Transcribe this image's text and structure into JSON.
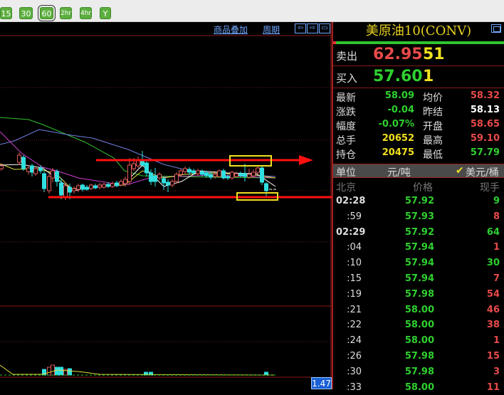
{
  "toolbar": {
    "periods": [
      "15",
      "30",
      "60",
      "2hr",
      "4hr",
      "Y"
    ],
    "selected": "60"
  },
  "chart": {
    "overlay_link": "商品叠加",
    "period_link": "周期",
    "icons": [
      "arrow-left-icon",
      "arrow-right-icon",
      "panel-toggle-icon"
    ],
    "volume_badge": "1.47"
  },
  "panel": {
    "title": "美原油10(CONV)",
    "sell": {
      "label": "卖出",
      "price": "62.95",
      "qty": "51"
    },
    "buy": {
      "label": "买入",
      "price": "57.60",
      "qty": "1"
    },
    "stats": [
      {
        "l1": "最新",
        "v1": "58.09",
        "c1": "#2fd02f",
        "l2": "均价",
        "v2": "58.32",
        "c2": "#e84a4a"
      },
      {
        "l1": "涨跌",
        "v1": "-0.04",
        "c1": "#2fd02f",
        "l2": "昨结",
        "v2": "58.13",
        "c2": "#ffffff"
      },
      {
        "l1": "幅度",
        "v1": "-0.07%",
        "c1": "#2fd02f",
        "l2": "开盘",
        "v2": "58.65",
        "c2": "#e84a4a"
      },
      {
        "l1": "总手",
        "v1": "20652",
        "c1": "#f0e020",
        "l2": "最高",
        "v2": "59.10",
        "c2": "#e84a4a"
      },
      {
        "l1": "持仓",
        "v1": "20475",
        "c1": "#f0e020",
        "l2": "最低",
        "v2": "57.79",
        "c2": "#2fd02f"
      }
    ],
    "unit": {
      "label": "单位",
      "option1": "元/吨",
      "option2": "美元/桶",
      "checked": "option2"
    },
    "ticks_header": {
      "time": "北京",
      "price": "价格",
      "qty": "现手"
    },
    "ticks": [
      {
        "time": "02:28",
        "price": "57.92",
        "qty": "9",
        "color": "#2fd02f"
      },
      {
        "time": ":59",
        "price": "57.93",
        "qty": "8",
        "color": "#e84a4a"
      },
      {
        "time": "02:29",
        "price": "57.92",
        "qty": "64",
        "color": "#2fd02f"
      },
      {
        "time": ":04",
        "price": "57.94",
        "qty": "1",
        "color": "#e84a4a"
      },
      {
        "time": ":10",
        "price": "57.94",
        "qty": "30",
        "color": "#2fd02f"
      },
      {
        "time": ":15",
        "price": "57.94",
        "qty": "7",
        "color": "#e84a4a"
      },
      {
        "time": ":19",
        "price": "57.98",
        "qty": "54",
        "color": "#e84a4a"
      },
      {
        "time": ":21",
        "price": "58.00",
        "qty": "46",
        "color": "#e84a4a"
      },
      {
        "time": ":22",
        "price": "58.00",
        "qty": "38",
        "color": "#e84a4a"
      },
      {
        "time": ":24",
        "price": "58.00",
        "qty": "1",
        "color": "#e84a4a"
      },
      {
        "time": ":26",
        "price": "57.98",
        "qty": "15",
        "color": "#e84a4a"
      },
      {
        "time": ":30",
        "price": "57.98",
        "qty": "3",
        "color": "#e84a4a"
      },
      {
        "time": ":33",
        "price": "58.00",
        "qty": "11",
        "color": "#e84a4a"
      }
    ]
  },
  "colors": {
    "up": "#e05a5a",
    "down": "#30e0e0",
    "annotation": "#ff1010",
    "highlight": "#f0e020"
  }
}
